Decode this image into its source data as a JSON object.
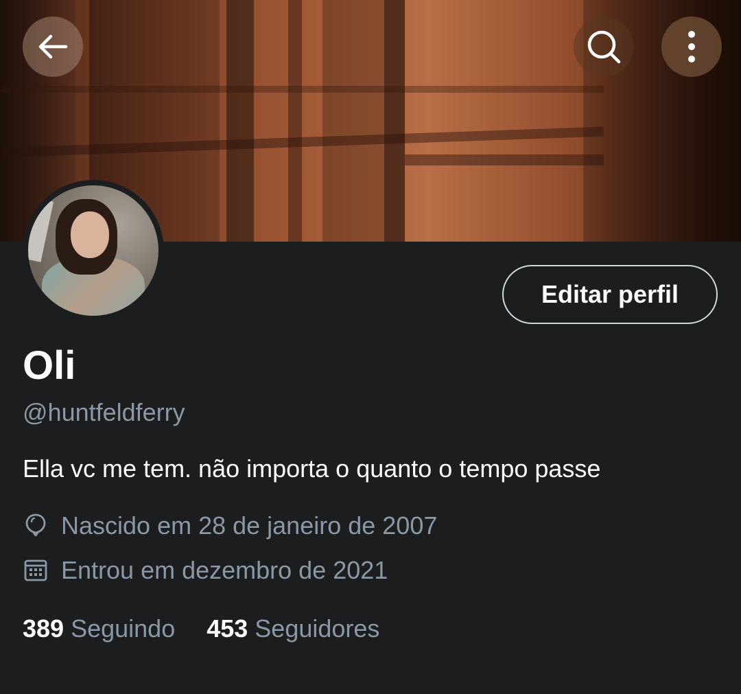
{
  "header": {
    "back_icon": "arrow-left-icon",
    "search_icon": "search-icon",
    "more_icon": "more-vertical-icon"
  },
  "profile": {
    "name": "Oli",
    "handle": "@huntfeldferry",
    "bio": "Ella vc me tem. não importa o quanto o tempo passe",
    "birth": "Nascido em 28 de janeiro de 2007",
    "joined": "Entrou em dezembro de 2021",
    "edit_button": "Editar perfil"
  },
  "stats": {
    "following_count": "389",
    "following_label": "Seguindo",
    "followers_count": "453",
    "followers_label": "Seguidores"
  },
  "colors": {
    "background": "#1c1d1e",
    "primary_text": "#ffffff",
    "secondary_text": "#8b98a5",
    "button_border": "#cfd9de"
  }
}
